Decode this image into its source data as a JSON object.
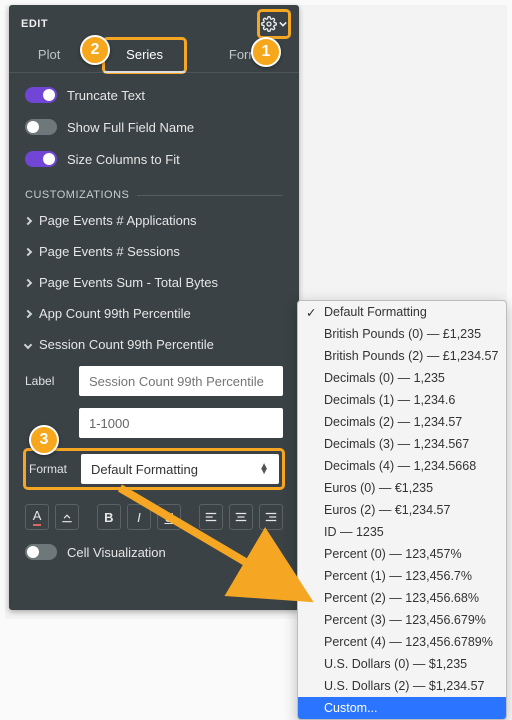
{
  "panel": {
    "title": "EDIT",
    "tabs": {
      "plot": "Plot",
      "series": "Series",
      "format": "Format"
    },
    "toggles": {
      "truncate": "Truncate Text",
      "fullname": "Show Full Field Name",
      "fit": "Size Columns to Fit",
      "cellvis": "Cell Visualization"
    },
    "section": "CUSTOMIZATIONS",
    "accordion": [
      "Page Events # Applications",
      "Page Events # Sessions",
      "Page Events Sum - Total Bytes",
      "App Count 99th Percentile",
      "Session Count 99th Percentile"
    ],
    "labels": {
      "label": "Label",
      "format": "Format"
    },
    "inputs": {
      "label_placeholder": "Session Count 99th Percentile",
      "range": "1-1000",
      "format_value": "Default Formatting"
    }
  },
  "menu": [
    "Default Formatting",
    "British Pounds (0) — £1,235",
    "British Pounds (2) — £1,234.57",
    "Decimals (0) — 1,235",
    "Decimals (1) — 1,234.6",
    "Decimals (2) — 1,234.57",
    "Decimals (3) — 1,234.567",
    "Decimals (4) — 1,234.5668",
    "Euros (0) — €1,235",
    "Euros (2) — €1,234.57",
    "ID — 1235",
    "Percent (0) — 123,457%",
    "Percent (1) — 123,456.7%",
    "Percent (2) — 123,456.68%",
    "Percent (3) — 123,456.679%",
    "Percent (4) — 123,456.6789%",
    "U.S. Dollars (0) — $1,235",
    "U.S. Dollars (2) — $1,234.57",
    "Custom..."
  ],
  "callouts": {
    "one": "1",
    "two": "2",
    "three": "3"
  }
}
